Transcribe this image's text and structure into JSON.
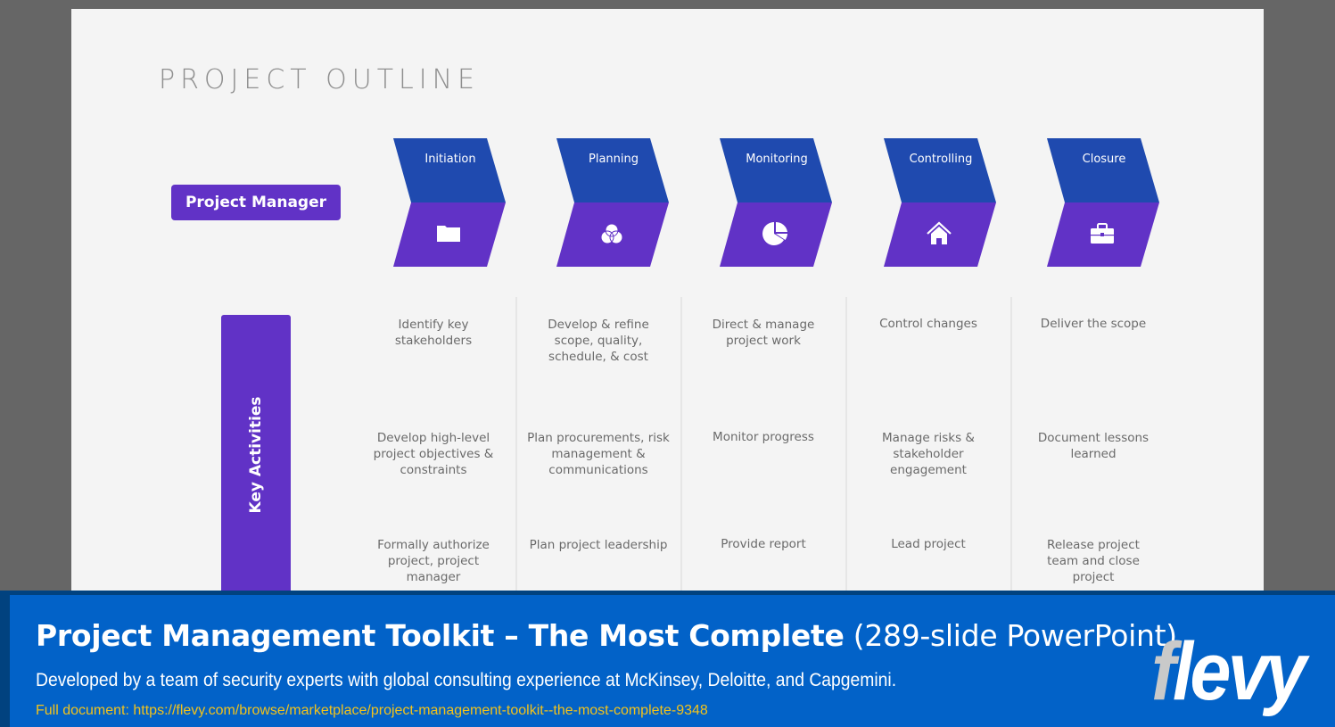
{
  "slide": {
    "title": "PROJECT OUTLINE",
    "role_badge": "Project Manager",
    "key_activities_label": "Key Activities",
    "colors": {
      "phase_top": "#1f4aaf",
      "phase_bottom": "#6132c6",
      "accent": "#6132c6",
      "text_gray": "#6a6a6a"
    },
    "phases": [
      {
        "label": "Initiation",
        "icon": "folder-icon",
        "activities": [
          "Identify key stakeholders",
          "Develop high-level project objectives & constraints",
          "Formally authorize project, project manager"
        ]
      },
      {
        "label": "Planning",
        "icon": "venn-diagram-icon",
        "activities": [
          "Develop & refine scope, quality, schedule, & cost",
          "Plan procurements, risk management & communications",
          "Plan project leadership"
        ]
      },
      {
        "label": "Monitoring",
        "icon": "pie-chart-icon",
        "activities": [
          "Direct & manage project work",
          "Monitor progress",
          "Provide report"
        ]
      },
      {
        "label": "Controlling",
        "icon": "home-icon",
        "activities": [
          "Control changes",
          "Manage risks & stakeholder engagement",
          "Lead project"
        ]
      },
      {
        "label": "Closure",
        "icon": "briefcase-icon",
        "activities": [
          "Deliver the scope",
          "Document lessons learned",
          "Release project team and close project"
        ]
      }
    ]
  },
  "banner": {
    "title_bold": "Project Management Toolkit – The Most Complete",
    "title_light": " (289-slide PowerPoint)",
    "subtitle": "Developed by a team of security experts with global consulting experience at McKinsey, Deloitte, and Capgemini.",
    "link_text": "Full document: https://flevy.com/browse/marketplace/project-management-toolkit--the-most-complete-9348",
    "logo_first": "f",
    "logo_rest": "levy",
    "colors": {
      "background": "#0262c8",
      "border": "#01427f",
      "link": "#f2c21b"
    }
  }
}
